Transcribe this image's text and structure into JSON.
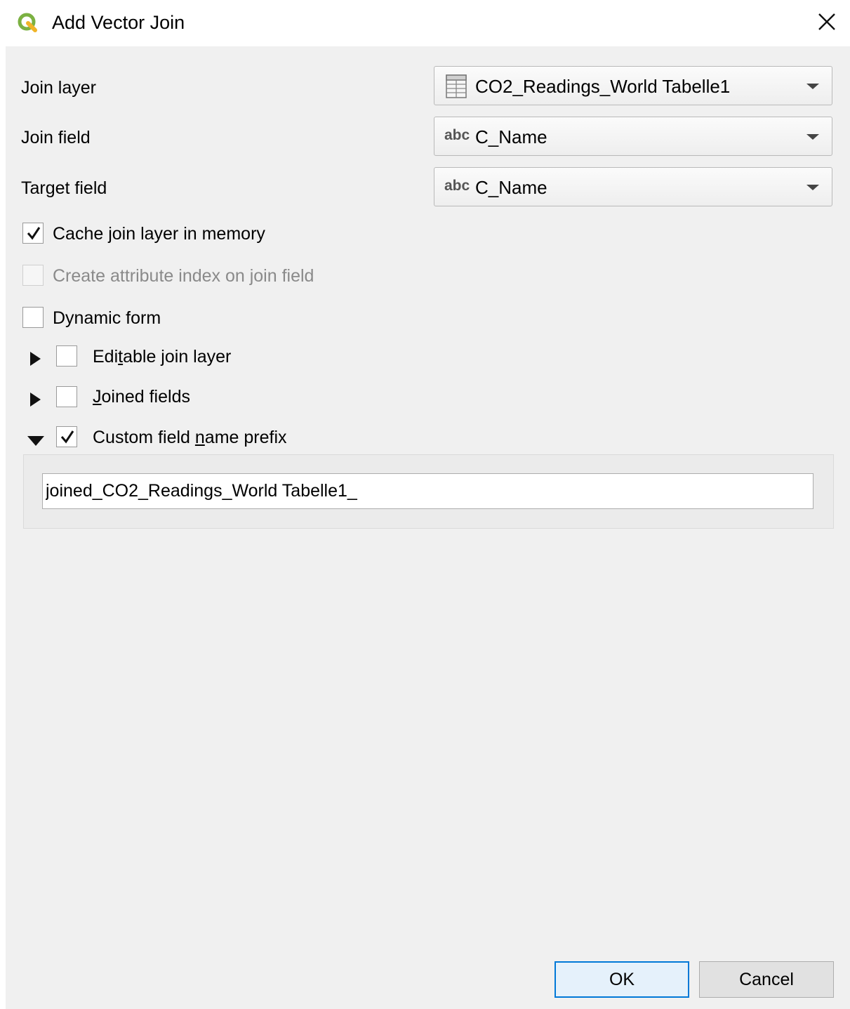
{
  "window": {
    "title": "Add Vector Join",
    "icons": {
      "app": "qgis-logo-icon",
      "close": "close-icon"
    }
  },
  "form": {
    "join_layer": {
      "label": "Join layer",
      "value": "CO2_Readings_World Tabelle1",
      "icon": "table-layer-icon"
    },
    "join_field": {
      "label": "Join field",
      "type_badge": "abc",
      "value": "C_Name"
    },
    "target_field": {
      "label": "Target field",
      "type_badge": "abc",
      "value": "C_Name"
    }
  },
  "options": {
    "cache": {
      "label": "Cache join layer in memory",
      "checked": true
    },
    "attribute_index": {
      "label": "Create attribute index on join field",
      "checked": false,
      "enabled": false
    },
    "dynamic_form": {
      "label": "Dynamic form",
      "checked": false
    }
  },
  "groups": {
    "editable": {
      "label_pre": "Edi",
      "label_mnemonic": "t",
      "label_post": "able join layer",
      "checked": false,
      "expanded": false
    },
    "joined_fields": {
      "label_mnemonic": "J",
      "label_post": "oined fields",
      "checked": false,
      "expanded": false
    },
    "prefix": {
      "label_pre": "Custom field ",
      "label_mnemonic": "n",
      "label_post": "ame prefix",
      "checked": true,
      "expanded": true,
      "value": "joined_CO2_Readings_World Tabelle1_"
    }
  },
  "buttons": {
    "ok": "OK",
    "cancel": "Cancel"
  }
}
